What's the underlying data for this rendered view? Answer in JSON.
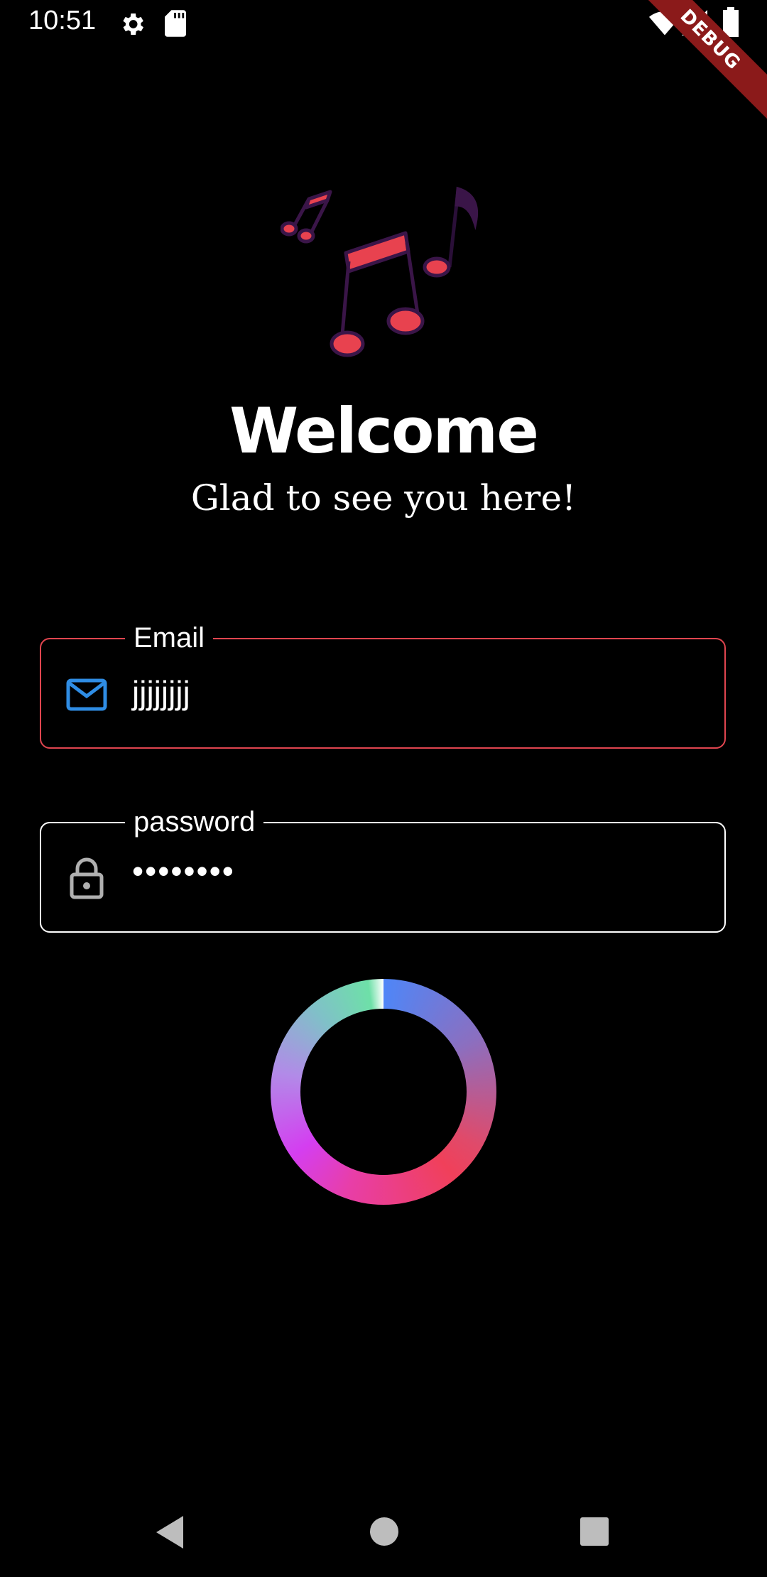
{
  "status_bar": {
    "time": "10:51",
    "icons": [
      "settings-icon",
      "sd-card-icon",
      "wifi-icon",
      "signal-icon",
      "battery-icon"
    ]
  },
  "debug_banner": "DEBUG",
  "logo": {
    "icon": "music-notes-icon",
    "colors": {
      "note": "#e8424f",
      "outline": "#3a1548"
    }
  },
  "welcome": {
    "title": "Welcome",
    "subtitle": "Glad to see you here!"
  },
  "form": {
    "email": {
      "label": "Email",
      "value": "jjjjjjjj",
      "icon": "mail-icon",
      "border_color": "#e0454f",
      "icon_color": "#2f8de4"
    },
    "password": {
      "label": "password",
      "value": "••••••••",
      "icon": "lock-icon",
      "border_color": "#ffffff"
    }
  },
  "loading": {
    "icon": "loading-spinner"
  },
  "nav_bar": {
    "buttons": [
      "back-button",
      "home-button",
      "recents-button"
    ]
  },
  "colors": {
    "background": "#000000",
    "accent": "#e0454f"
  }
}
